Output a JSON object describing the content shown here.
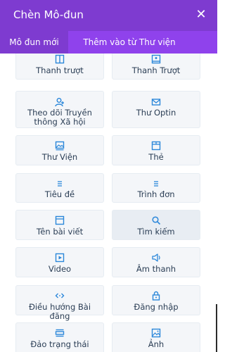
{
  "dialog": {
    "title": "Chèn Mô-đun",
    "close_symbol": "✕"
  },
  "tabs": [
    {
      "label": "Mô đun mới",
      "active": true
    },
    {
      "label": "Thêm vào từ Thư viện",
      "active": false
    }
  ],
  "modules": [
    {
      "label": "Thanh trượt",
      "icon": "slider-icon"
    },
    {
      "label": "Thanh Trượt",
      "icon": "slider-icon"
    },
    {
      "label": "Theo dõi Truyền thông Xã hội",
      "icon": "social-follow-icon"
    },
    {
      "label": "Thư Optin",
      "icon": "email-icon"
    },
    {
      "label": "Thư Viện",
      "icon": "gallery-icon"
    },
    {
      "label": "Thẻ",
      "icon": "tabs-icon"
    },
    {
      "label": "Tiêu đề",
      "icon": "title-icon"
    },
    {
      "label": "Trình đơn",
      "icon": "menu-icon"
    },
    {
      "label": "Tên bài viết",
      "icon": "post-title-icon"
    },
    {
      "label": "Tìm kiếm",
      "icon": "search-icon"
    },
    {
      "label": "Video",
      "icon": "video-icon"
    },
    {
      "label": "Âm thanh",
      "icon": "audio-icon"
    },
    {
      "label": "Điều hướng Bài đăng",
      "icon": "post-navigation-icon"
    },
    {
      "label": "Đăng nhập",
      "icon": "login-icon"
    },
    {
      "label": "Đảo trạng thái",
      "icon": "toggle-icon"
    },
    {
      "label": "Ảnh",
      "icon": "image-icon"
    }
  ],
  "colors": {
    "header": "#7e3bd0",
    "tabs_bar": "#8f42ec",
    "icon": "#2b87da",
    "tile_bg": "#f4f6f9",
    "text": "#2b3e55"
  }
}
